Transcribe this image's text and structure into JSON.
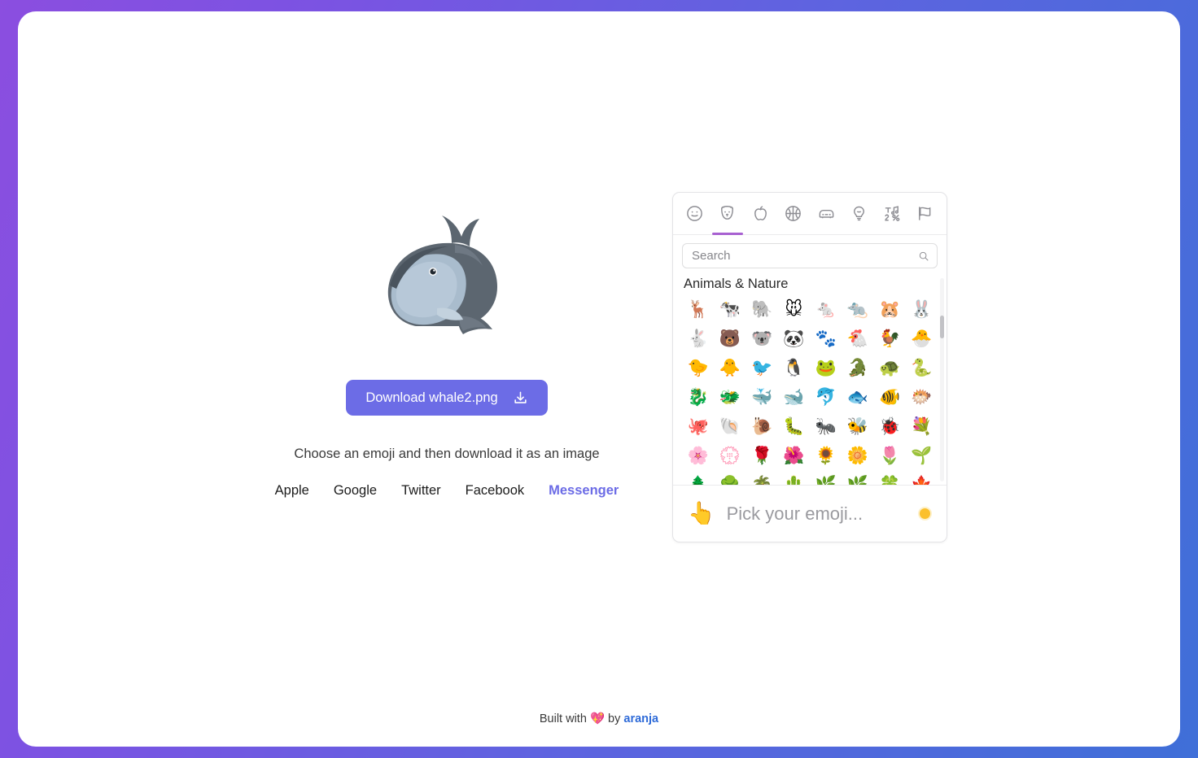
{
  "download": {
    "label": "Download whale2.png",
    "icon": "download-icon",
    "color": "#6c6ce6"
  },
  "hint": "Choose an emoji and then download it as an image",
  "providers": [
    {
      "label": "Apple",
      "active": false
    },
    {
      "label": "Google",
      "active": false
    },
    {
      "label": "Twitter",
      "active": false
    },
    {
      "label": "Facebook",
      "active": false
    },
    {
      "label": "Messenger",
      "active": true
    }
  ],
  "preview": {
    "emoji_name": "whale-emoji",
    "filename": "whale2.png"
  },
  "picker": {
    "tabs": [
      {
        "name": "smileys-tab",
        "icon": "smiley-face-icon",
        "active": false
      },
      {
        "name": "animals-tab",
        "icon": "dog-face-icon",
        "active": true
      },
      {
        "name": "food-tab",
        "icon": "apple-icon",
        "active": false
      },
      {
        "name": "activity-tab",
        "icon": "basketball-icon",
        "active": false
      },
      {
        "name": "travel-tab",
        "icon": "car-icon",
        "active": false
      },
      {
        "name": "objects-tab",
        "icon": "lightbulb-icon",
        "active": false
      },
      {
        "name": "symbols-tab",
        "icon": "symbols-icon",
        "active": false
      },
      {
        "name": "flags-tab",
        "icon": "flag-icon",
        "active": false
      }
    ],
    "active_tab_color": "#a861d1",
    "search": {
      "placeholder": "Search",
      "value": "",
      "icon": "search-icon"
    },
    "group_title": "Animals & Nature",
    "emojis": [
      "🦌",
      "🐄",
      "🐘",
      "🐭",
      "🐁",
      "🐀",
      "🐹",
      "🐰",
      "🐇",
      "🐻",
      "🐨",
      "🐼",
      "🐾",
      "🐔",
      "🐓",
      "🐣",
      "🐤",
      "🐥",
      "🐦",
      "🐧",
      "🐸",
      "🐊",
      "🐢",
      "🐍",
      "🐉",
      "🐲",
      "🐳",
      "🐋",
      "🐬",
      "🐟",
      "🐠",
      "🐡",
      "🐙",
      "🐚",
      "🐌",
      "🐛",
      "🐜",
      "🐝",
      "🐞",
      "💐",
      "🌸",
      "💮",
      "🌹",
      "🌺",
      "🌻",
      "🌼",
      "🌷",
      "🌱",
      "🌲",
      "🌳",
      "🌴",
      "🌵",
      "🌿",
      "🌿",
      "🍀",
      "🍁"
    ],
    "footer": {
      "finger": "👆",
      "placeholder": "Pick your emoji...",
      "tone_color": "#fbc02d",
      "tone_name": "skin-tone-selector"
    }
  },
  "footer": {
    "prefix": "Built with ",
    "heart": "💖",
    "middle": " by ",
    "link": "aranja",
    "link_color": "#2f6bd8"
  }
}
